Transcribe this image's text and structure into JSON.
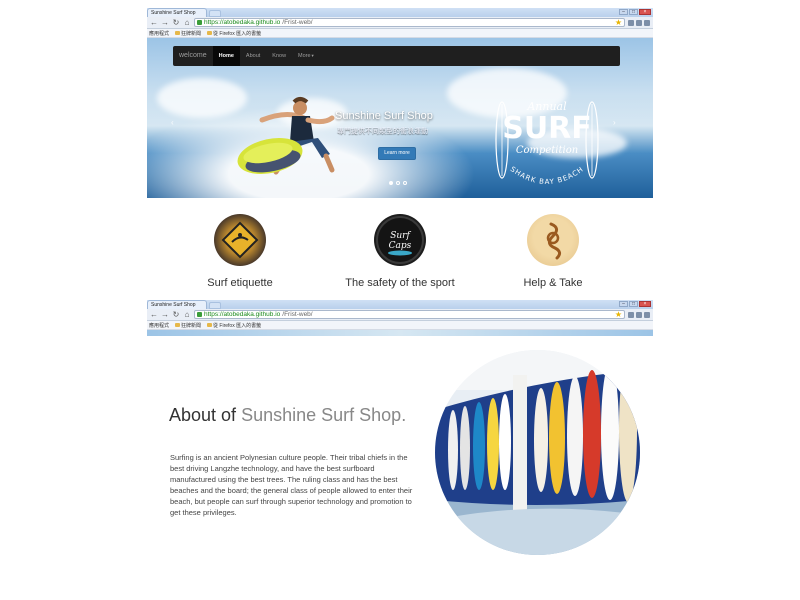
{
  "browser": {
    "tab_title": "Sunshine Surf Shop",
    "url_host": "https://atobedaka.github.io",
    "url_path": "/Frist-web/",
    "bookmarks": [
      "應用程式",
      "狂牌新聞",
      "從 Firefox 匯入的書籤"
    ]
  },
  "navbar": {
    "brand": "welcome",
    "links": [
      "Home",
      "About",
      "Know",
      "More"
    ]
  },
  "hero": {
    "title": "Sunshine Surf Shop",
    "subtitle": "專門提供不同類型的衝浪運動",
    "button": "Learn more",
    "badge": {
      "top": "Annual",
      "main": "SURF",
      "sub": "Competition",
      "bottom": "SHARK BAY BEACH"
    }
  },
  "features": [
    {
      "title": "Surf etiquette",
      "icon": "surf-sign-icon"
    },
    {
      "title": "The safety of the sport",
      "icon": "surf-caps-logo-icon"
    },
    {
      "title": "Help & Take",
      "icon": "rope-knot-icon"
    }
  ],
  "about": {
    "heading_prefix": "About of",
    "heading_highlight": "Sunshine Surf Shop.",
    "body": "Surfing is an ancient Polynesian culture people. Their tribal chiefs in the best driving Langzhe technology, and have the best surfboard manufactured using the best trees. The ruling class and has the best beaches and the board; the general class of people allowed to enter their beach, but people can surf through superior technology and promotion to get these privileges."
  },
  "colors": {
    "navbar_bg": "#1f1f1f",
    "button_blue": "#337ab7",
    "url_green": "#1a8a1a"
  }
}
